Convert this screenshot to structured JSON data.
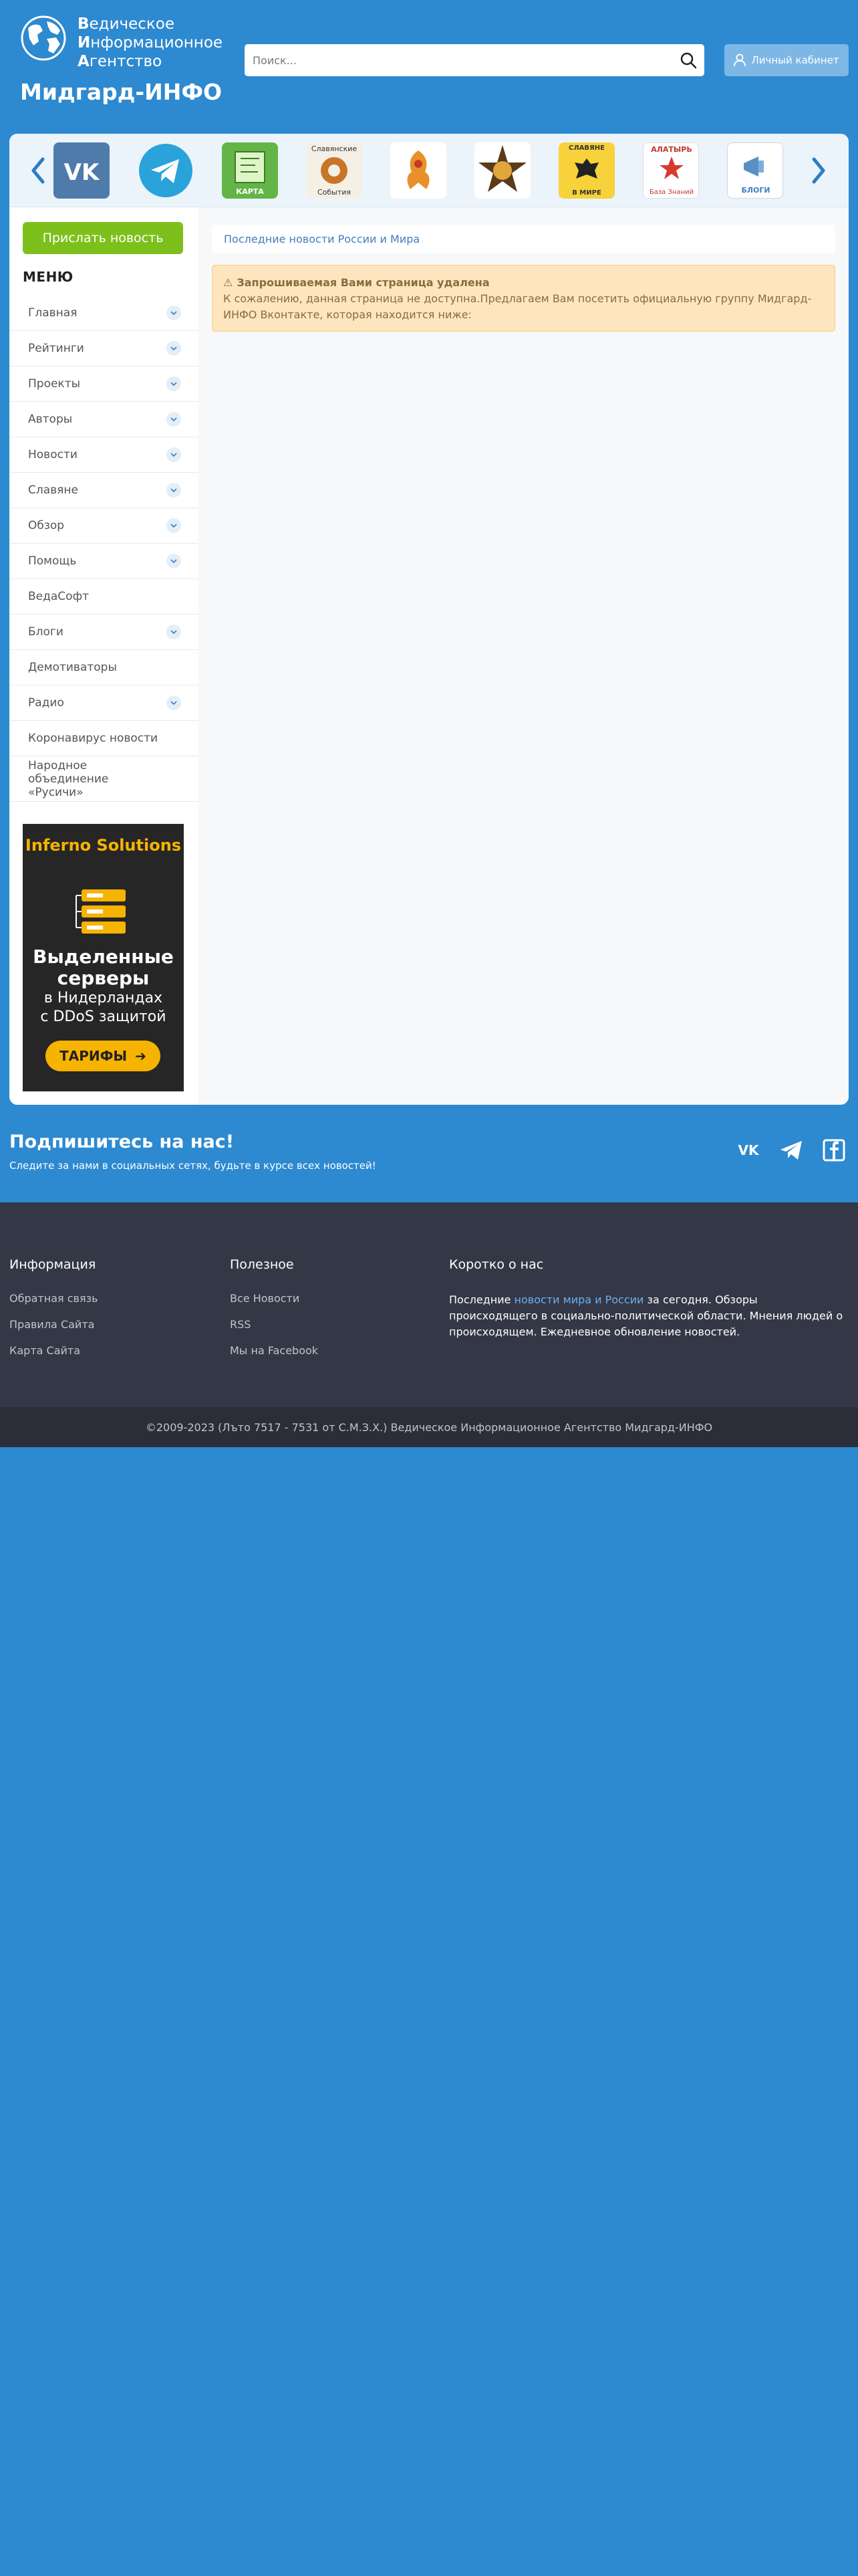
{
  "header": {
    "logo_lines": [
      {
        "initial": "В",
        "rest": "едическое"
      },
      {
        "initial": "И",
        "rest": "нформационное"
      },
      {
        "initial": "А",
        "rest": "гентство"
      }
    ],
    "site_name": "Мидгард-ИНФО",
    "search_placeholder": "Поиск...",
    "account_label": "Личный кабинет"
  },
  "carousel": {
    "items": [
      {
        "name": "vk",
        "label": ""
      },
      {
        "name": "telegram",
        "label": ""
      },
      {
        "name": "map",
        "label": "КАРТА"
      },
      {
        "name": "slavic-events",
        "label_top": "Славянские",
        "label_bottom": "События"
      },
      {
        "name": "firebird",
        "label": ""
      },
      {
        "name": "star-emblem",
        "label": ""
      },
      {
        "name": "slavs-in-world",
        "label_top": "СЛАВЯНЕ",
        "label_bottom": "В МИРЕ"
      },
      {
        "name": "alatyr",
        "label_top": "АЛАТЫРЬ",
        "label_bottom": "База Знаний"
      },
      {
        "name": "blogs",
        "label": "БЛОГИ"
      }
    ]
  },
  "sidebar": {
    "send_news": "Прислать новость",
    "menu_title": "МЕНЮ",
    "menu": [
      {
        "label": "Главная",
        "chevron": true
      },
      {
        "label": "Рейтинги",
        "chevron": true
      },
      {
        "label": "Проекты",
        "chevron": true
      },
      {
        "label": "Авторы",
        "chevron": true
      },
      {
        "label": "Новости",
        "chevron": true
      },
      {
        "label": "Славяне",
        "chevron": true
      },
      {
        "label": "Обзор",
        "chevron": true
      },
      {
        "label": "Помощь",
        "chevron": true
      },
      {
        "label": "ВедаСофт",
        "chevron": false
      },
      {
        "label": "Блоги",
        "chevron": true
      },
      {
        "label": "Демотиваторы",
        "chevron": false
      },
      {
        "label": "Радио",
        "chevron": true
      },
      {
        "label": "Коронавирус новости",
        "chevron": false
      },
      {
        "label": "Народное объединение «Русичи»",
        "chevron": false
      }
    ],
    "ad": {
      "title": "Inferno Solutions",
      "line1": "Выделенные",
      "line2": "серверы",
      "line3": "в Нидерландах",
      "line4": "с DDoS защитой",
      "button": "ТАРИФЫ"
    }
  },
  "content": {
    "breadcrumb": "Последние новости России и Мира",
    "alert_title": "Запрошиваемая Вами страница удалена",
    "alert_text": "К сожалению, данная страница не доступна.Предлагаем Вам посетить официальную группу Мидгард-ИНФО Вконтакте, которая находится ниже:"
  },
  "subscribe": {
    "title": "Подпишитесь на нас!",
    "text": "Следите за нами в социальных сетях, будьте в курсе всех новостей!",
    "icons": [
      "vk-icon",
      "telegram-icon",
      "facebook-icon"
    ]
  },
  "footer": {
    "info_title": "Информация",
    "info_links": [
      "Обратная связь",
      "Правила Сайта",
      "Карта Сайта"
    ],
    "useful_title": "Полезное",
    "useful_links": [
      "Все Новости",
      "RSS",
      "Мы на Facebook"
    ],
    "about_title": "Коротко о нас",
    "about_prefix": "Последние ",
    "about_link": "новости мира и России",
    "about_suffix": " за сегодня. Обзоры происходящего в социально-политической области. Мнения людей о происходящем. Ежедневное обновление новостей.",
    "copyright": "©2009-2023 (Лъто 7517 - 7531 от С.М.З.Х.) Ведическое Информационное Агентство Мидгард-ИНФО"
  },
  "colors": {
    "page_bg": "#2d89d0",
    "send_news_bg": "#7dc01c",
    "footer_bg": "#343846",
    "alert_bg": "#fde5be",
    "ad_accent": "#f6b300"
  }
}
